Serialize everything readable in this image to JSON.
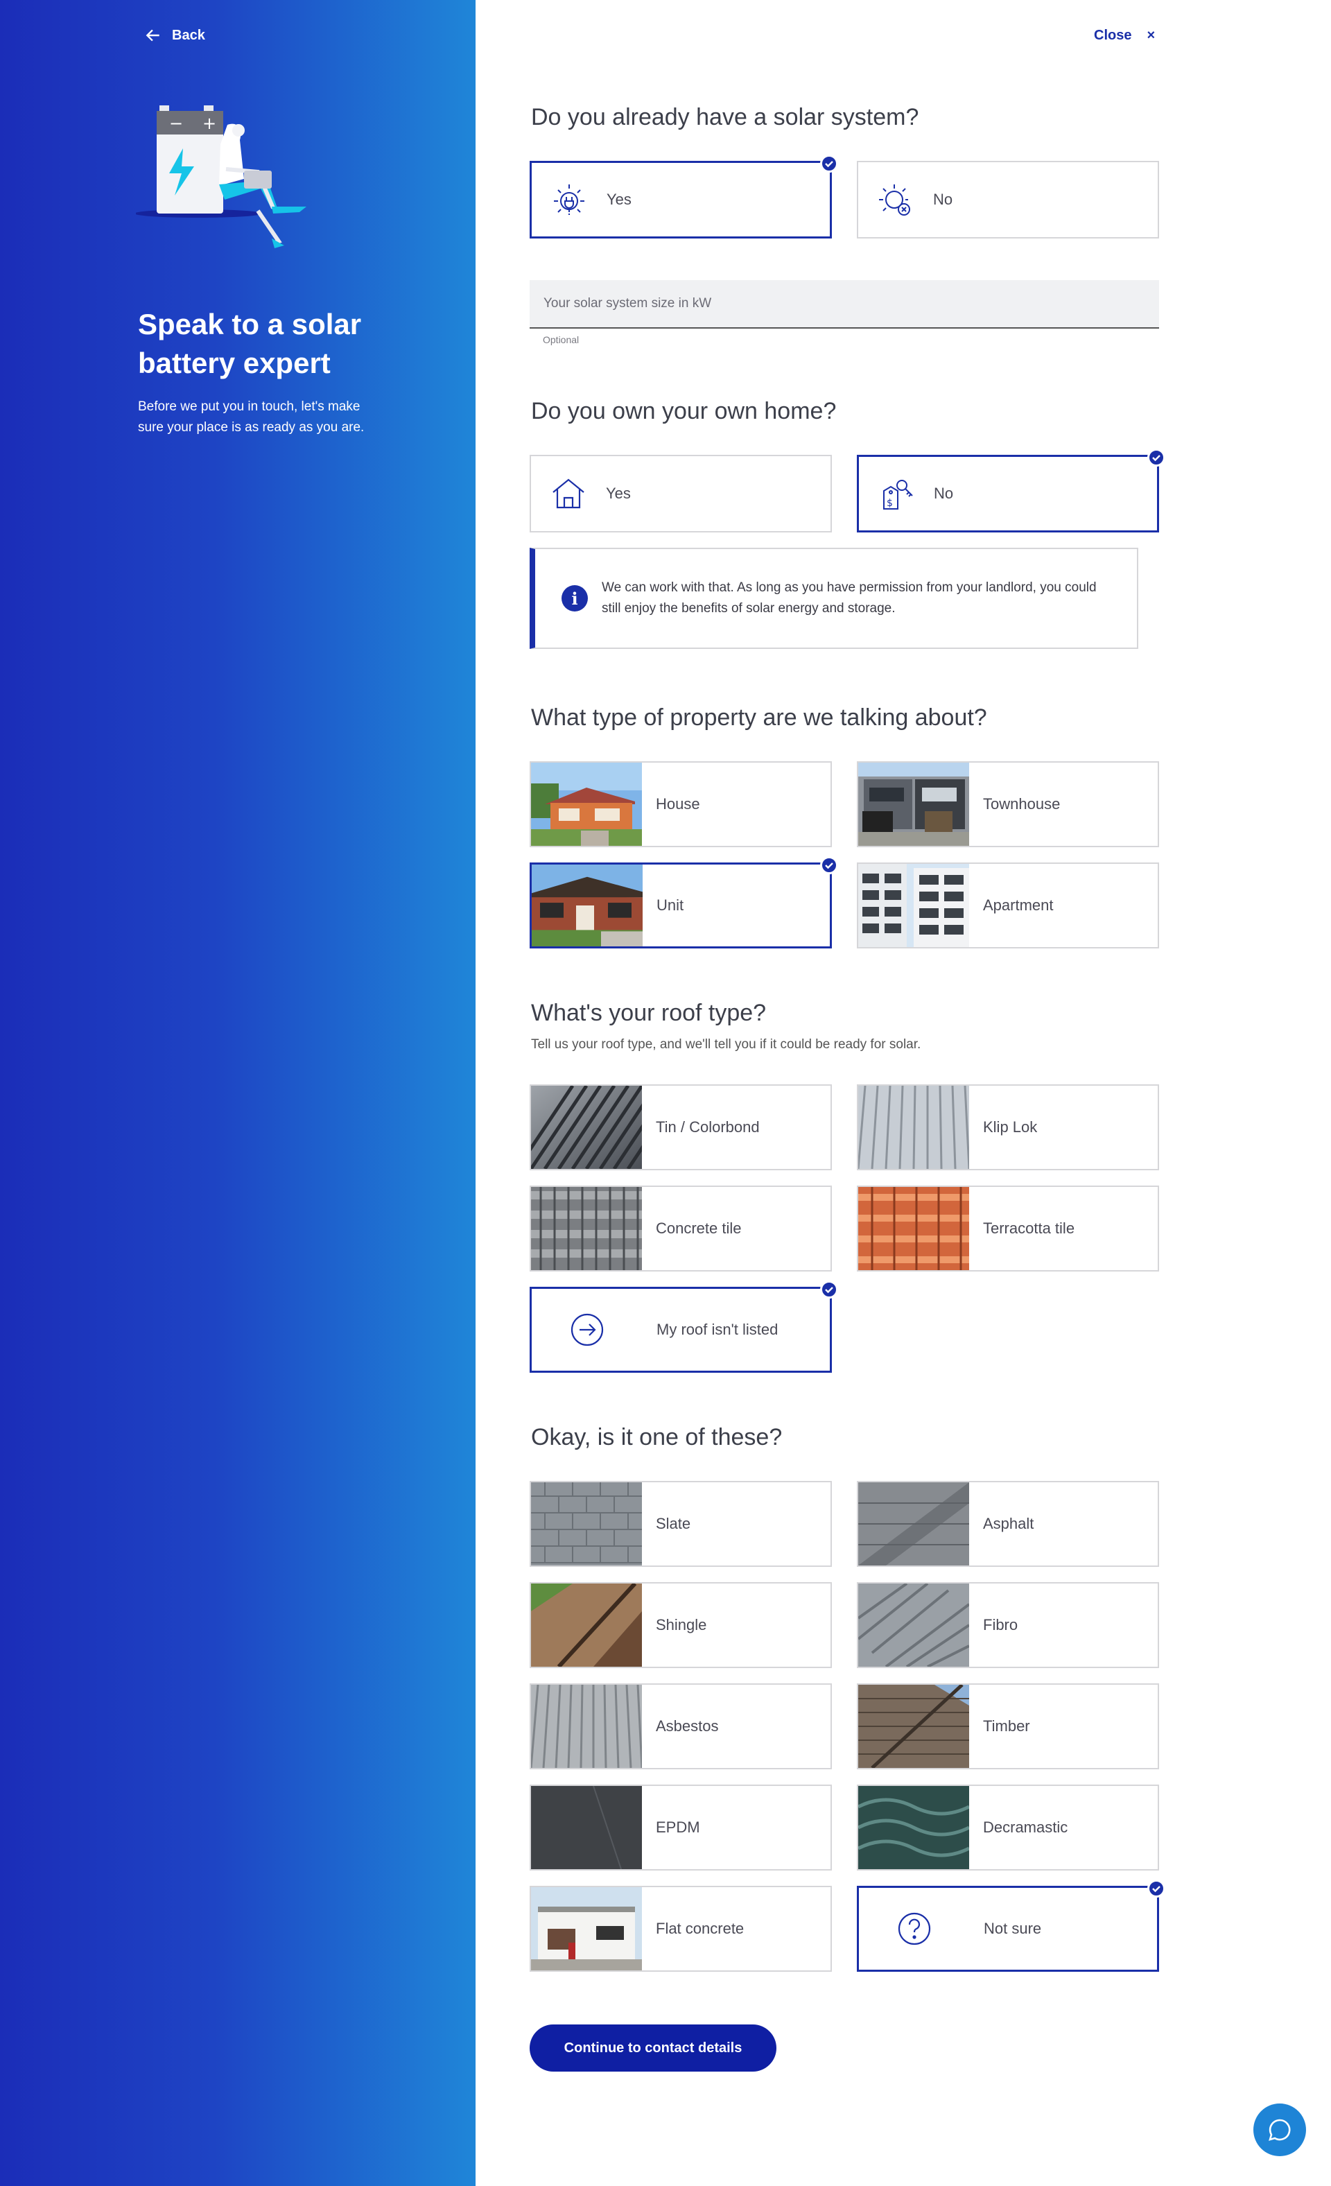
{
  "nav": {
    "back_label": "Back",
    "close_label": "Close",
    "close_symbol": "×"
  },
  "hero": {
    "title": "Speak to a solar battery expert",
    "subtitle": "Before we put you in touch, let's make sure your place is as ready as you are."
  },
  "q_solar": {
    "title": "Do you already have a solar system?",
    "options": [
      {
        "label": "Yes",
        "icon": "sun-plug-icon",
        "selected": true
      },
      {
        "label": "No",
        "icon": "sun-cross-icon",
        "selected": false
      }
    ],
    "size_placeholder": "Your solar system size in kW",
    "size_hint": "Optional"
  },
  "q_home": {
    "title": "Do you own your own home?",
    "options": [
      {
        "label": "Yes",
        "icon": "house-icon",
        "selected": false
      },
      {
        "label": "No",
        "icon": "key-tag-icon",
        "selected": true
      }
    ],
    "info": "We can work with that. As long as you have permission from your landlord, you could still enjoy the benefits of solar energy and storage."
  },
  "q_property": {
    "title": "What type of property are we talking about?",
    "options": [
      {
        "label": "House",
        "selected": false
      },
      {
        "label": "Townhouse",
        "selected": false
      },
      {
        "label": "Unit",
        "selected": true
      },
      {
        "label": "Apartment",
        "selected": false
      }
    ]
  },
  "q_roof": {
    "title": "What's your roof type?",
    "subtitle": "Tell us your roof type, and we'll tell you if it could be ready for solar.",
    "options": [
      {
        "label": "Tin / Colorbond",
        "selected": false
      },
      {
        "label": "Klip Lok",
        "selected": false
      },
      {
        "label": "Concrete tile",
        "selected": false
      },
      {
        "label": "Terracotta tile",
        "selected": false
      },
      {
        "label": "My roof isn't listed",
        "icon": "arrow-right-circle-icon",
        "selected": true
      }
    ]
  },
  "q_other": {
    "title": "Okay, is it one of these?",
    "options": [
      {
        "label": "Slate",
        "selected": false
      },
      {
        "label": "Asphalt",
        "selected": false
      },
      {
        "label": "Shingle",
        "selected": false
      },
      {
        "label": "Fibro",
        "selected": false
      },
      {
        "label": "Asbestos",
        "selected": false
      },
      {
        "label": "Timber",
        "selected": false
      },
      {
        "label": "EPDM",
        "selected": false
      },
      {
        "label": "Decramastic",
        "selected": false
      },
      {
        "label": "Flat concrete",
        "selected": false
      },
      {
        "label": "Not sure",
        "icon": "question-circle-icon",
        "selected": true
      }
    ]
  },
  "cta": {
    "label": "Continue to contact details"
  },
  "colors": {
    "accent": "#1a2fa8",
    "panel_start": "#1b2db8",
    "panel_end": "#1f86d8",
    "chat": "#1e84d6"
  }
}
